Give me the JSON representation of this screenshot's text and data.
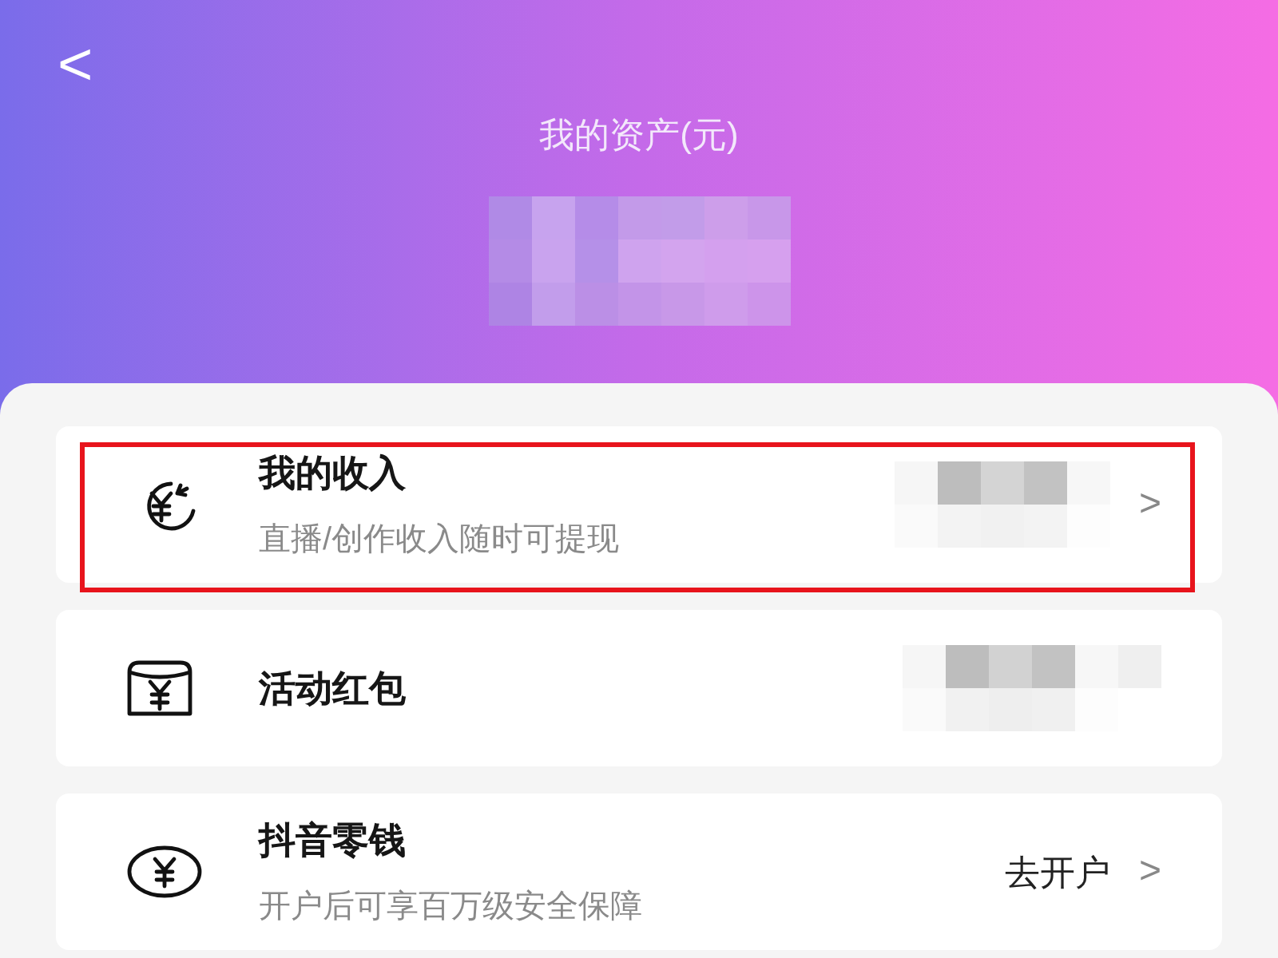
{
  "header": {
    "back": "<",
    "title": "我的资产(元)",
    "amount_hidden": true
  },
  "items": [
    {
      "kind": "income",
      "title": "我的收入",
      "subtitle": "直播/创作收入随时可提现",
      "value_hidden": true,
      "chevron": ">",
      "highlighted": true
    },
    {
      "kind": "packet",
      "title": "活动红包",
      "value_hidden": true,
      "highlighted": false
    },
    {
      "kind": "coin",
      "title": "抖音零钱",
      "subtitle": "开户后可享百万级安全保障",
      "action": "去开户",
      "chevron": ">",
      "highlighted": false
    }
  ]
}
